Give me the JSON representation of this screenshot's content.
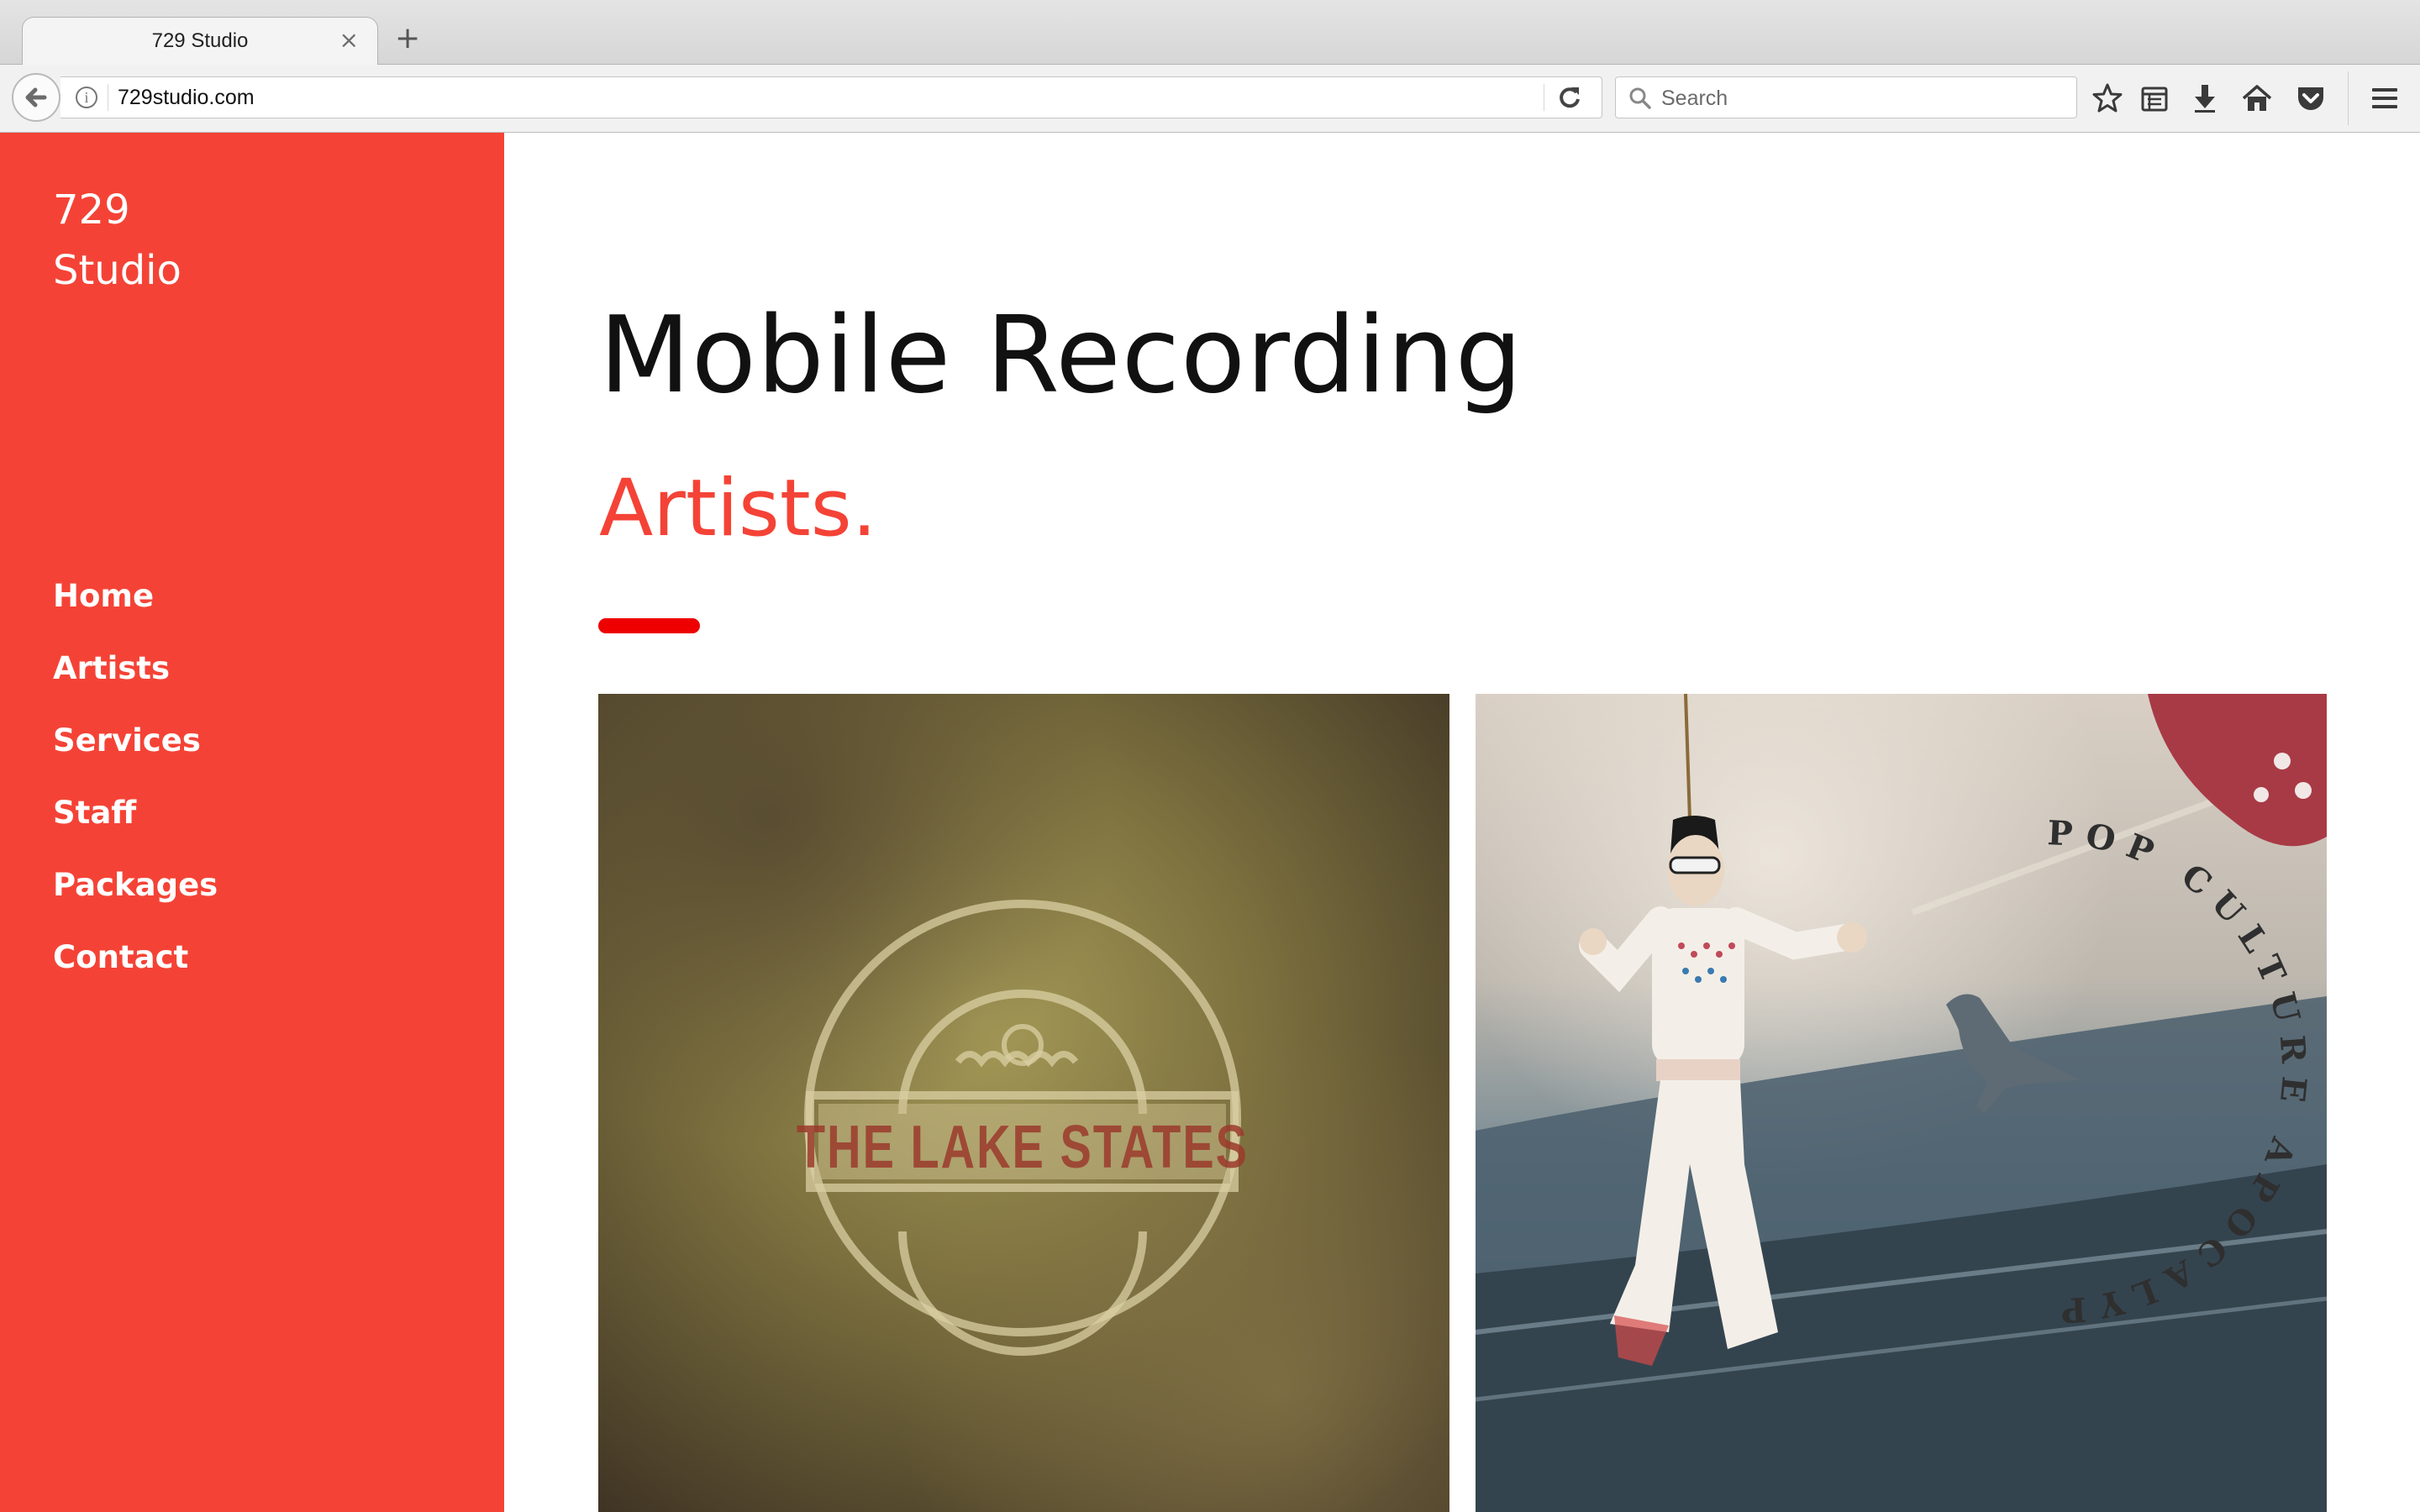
{
  "colors": {
    "brand": "#F44336",
    "accent": "#EE0000"
  },
  "browser": {
    "tab_title": "729 Studio",
    "tab_close": "×",
    "new_tab": "+",
    "url": "729studio.com",
    "search_placeholder": "Search",
    "toolbar_icons": [
      "bookmark-star-icon",
      "reading-list-icon",
      "download-icon",
      "home-icon",
      "pocket-icon",
      "hamburger-menu-icon"
    ]
  },
  "sidebar": {
    "logo_line1": "729",
    "logo_line2": "Studio",
    "nav": [
      "Home",
      "Artists",
      "Services",
      "Staff",
      "Packages",
      "Contact"
    ]
  },
  "main": {
    "title": "Mobile Recording",
    "section_heading": "Artists."
  },
  "artists": [
    {
      "name": "THE LAKE STATES"
    },
    {
      "name": "POP CULTURE APOCALYPSE"
    }
  ]
}
